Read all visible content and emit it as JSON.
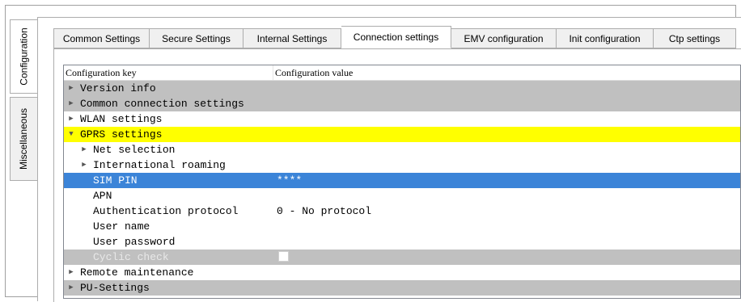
{
  "side_tabs": [
    {
      "label": "Configuration",
      "active": true
    },
    {
      "label": "Miscellaneous",
      "active": false
    }
  ],
  "tabs": [
    {
      "label": "Common Settings",
      "active": false
    },
    {
      "label": "Secure Settings",
      "active": false
    },
    {
      "label": "Internal Settings",
      "active": false
    },
    {
      "label": "Connection settings",
      "active": true
    },
    {
      "label": "EMV configuration",
      "active": false
    },
    {
      "label": "Init configuration",
      "active": false
    },
    {
      "label": "Ctp settings",
      "active": false
    }
  ],
  "tree": {
    "columns": [
      "Configuration key",
      "Configuration value"
    ],
    "rows": [
      {
        "key": "Version info",
        "value": "",
        "state": "collapsed",
        "highlight": "gray"
      },
      {
        "key": "Common connection settings",
        "value": "",
        "state": "collapsed",
        "highlight": "gray"
      },
      {
        "key": "WLAN settings",
        "value": "",
        "state": "collapsed",
        "highlight": "none"
      },
      {
        "key": "GPRS settings",
        "value": "",
        "state": "expanded",
        "highlight": "yellow"
      },
      {
        "key": "Net selection",
        "value": "",
        "state": "collapsed",
        "highlight": "none",
        "child": true
      },
      {
        "key": "International roaming",
        "value": "",
        "state": "collapsed",
        "highlight": "none",
        "child": true
      },
      {
        "key": "SIM PIN",
        "value": "****",
        "state": "leaf",
        "highlight": "selected",
        "child": true
      },
      {
        "key": "APN",
        "value": "",
        "state": "leaf",
        "highlight": "none",
        "child": true
      },
      {
        "key": "Authentication protocol",
        "value": "0 - No protocol",
        "state": "leaf",
        "highlight": "none",
        "child": true
      },
      {
        "key": "User name",
        "value": "",
        "state": "leaf",
        "highlight": "none",
        "child": true
      },
      {
        "key": "User password",
        "value": "",
        "state": "leaf",
        "highlight": "none",
        "child": true
      },
      {
        "key": "Cyclic check",
        "value": "",
        "state": "leaf",
        "highlight": "disabled",
        "child": true,
        "checkbox": false
      },
      {
        "key": "Remote maintenance",
        "value": "",
        "state": "collapsed",
        "highlight": "none"
      },
      {
        "key": "PU-Settings",
        "value": "",
        "state": "collapsed",
        "highlight": "gray"
      }
    ]
  }
}
